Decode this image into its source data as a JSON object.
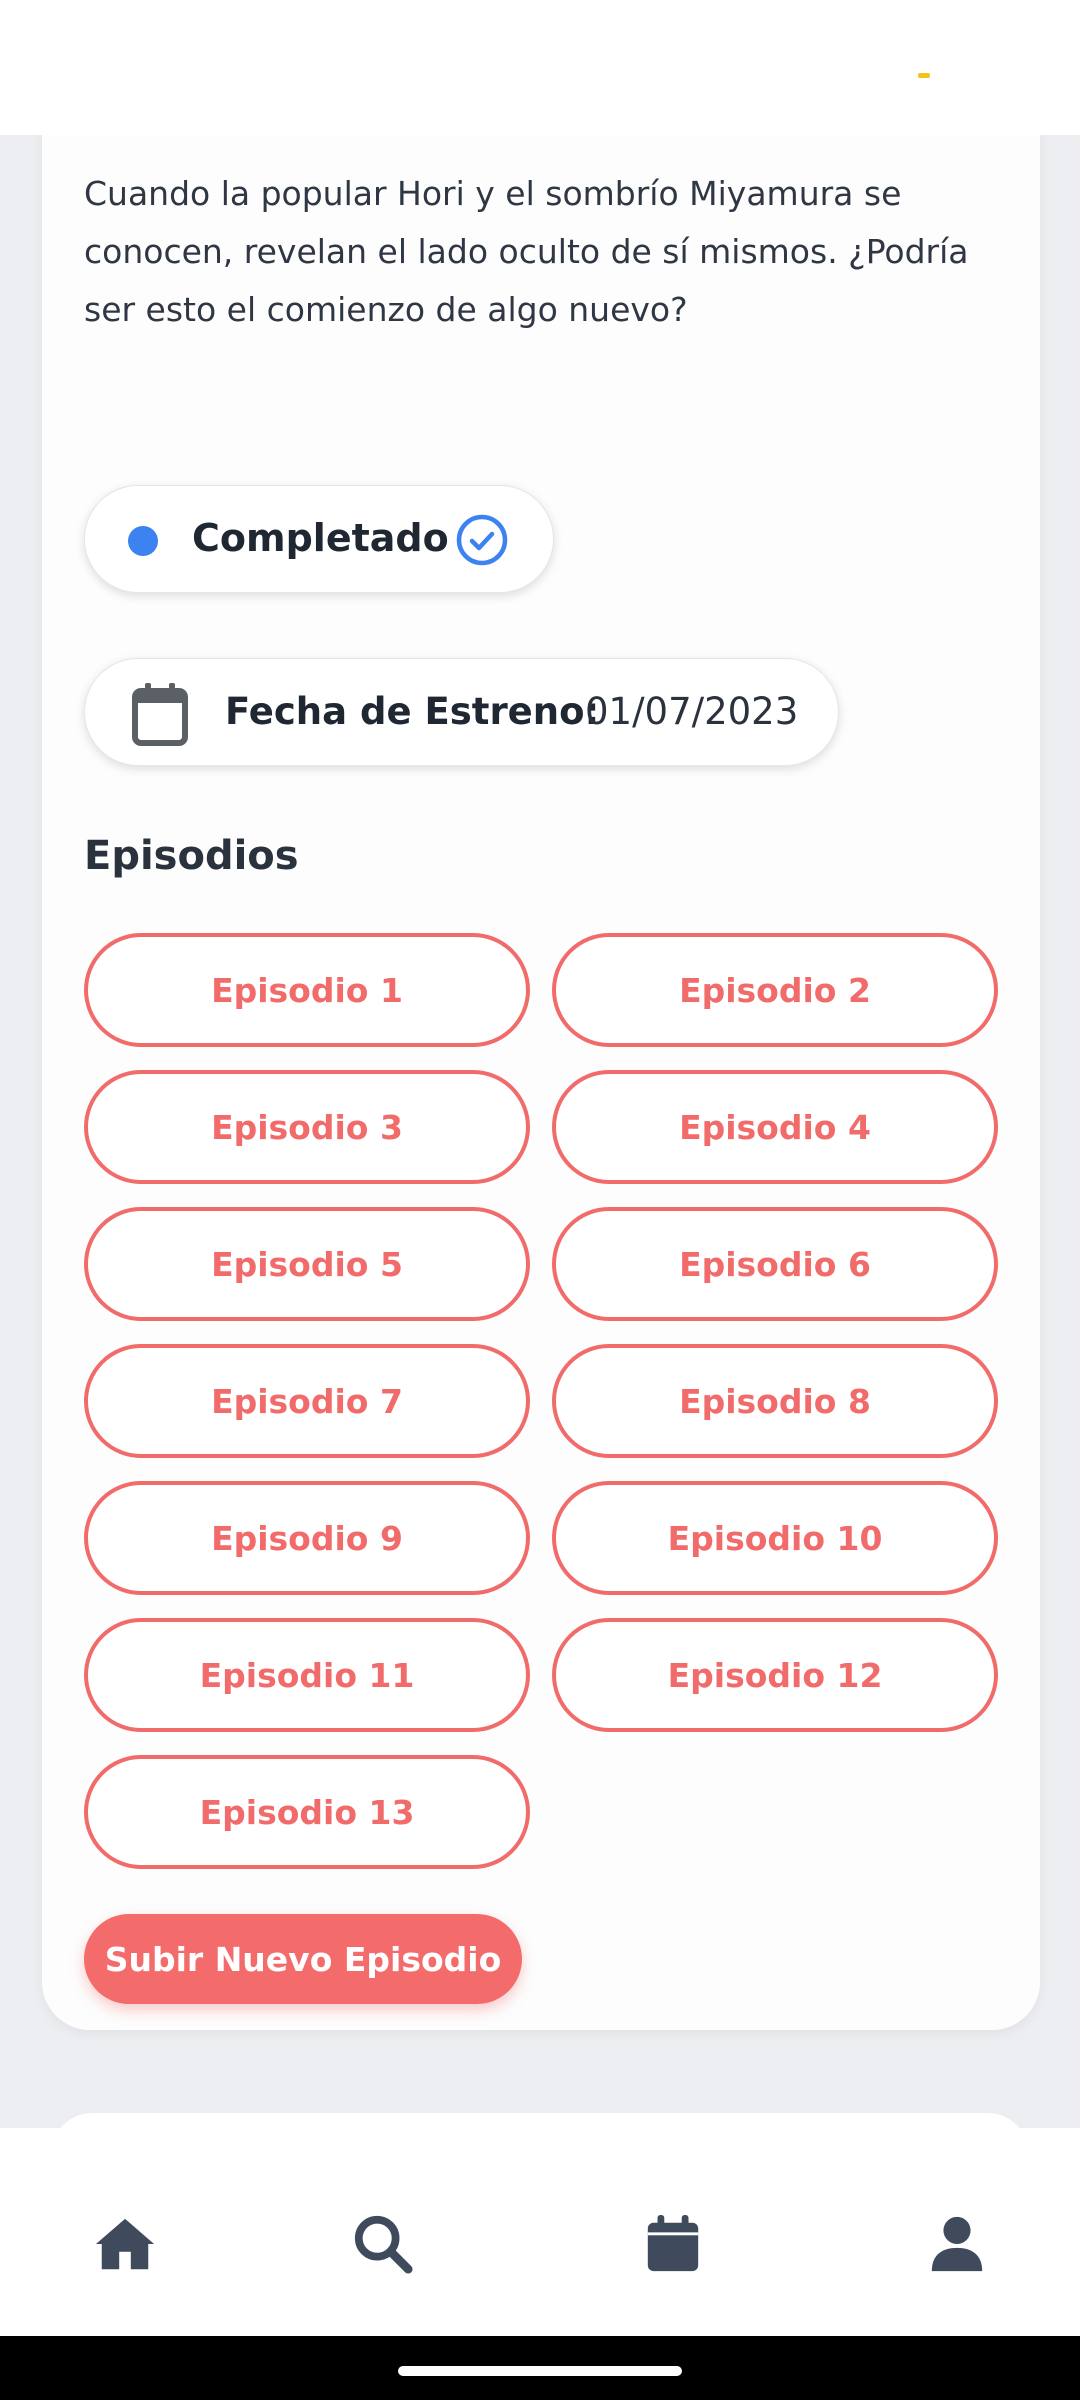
{
  "description": "Cuando la popular Hori y el sombrío Miyamura se conocen, revelan el lado oculto de sí mismos. ¿Podría ser esto el comienzo de algo nuevo?",
  "status": {
    "label": "Completado",
    "dot_color": "#3c82f0"
  },
  "release": {
    "label": "Fecha de Estreno:",
    "value": "01/07/2023"
  },
  "episodes": {
    "title": "Episodios",
    "items": [
      "Episodio 1",
      "Episodio 2",
      "Episodio 3",
      "Episodio 4",
      "Episodio 5",
      "Episodio 6",
      "Episodio 7",
      "Episodio 8",
      "Episodio 9",
      "Episodio 10",
      "Episodio 11",
      "Episodio 12",
      "Episodio 13"
    ]
  },
  "upload_button": "Subir Nuevo Episodio",
  "bottom_nav": {
    "items": [
      {
        "icon": "home-icon"
      },
      {
        "icon": "search-icon"
      },
      {
        "icon": "calendar-icon"
      },
      {
        "icon": "user-icon"
      }
    ]
  },
  "colors": {
    "accent": "#f26b6b",
    "status_blue": "#3c82f0",
    "nav_icon": "#3f4b5c"
  }
}
